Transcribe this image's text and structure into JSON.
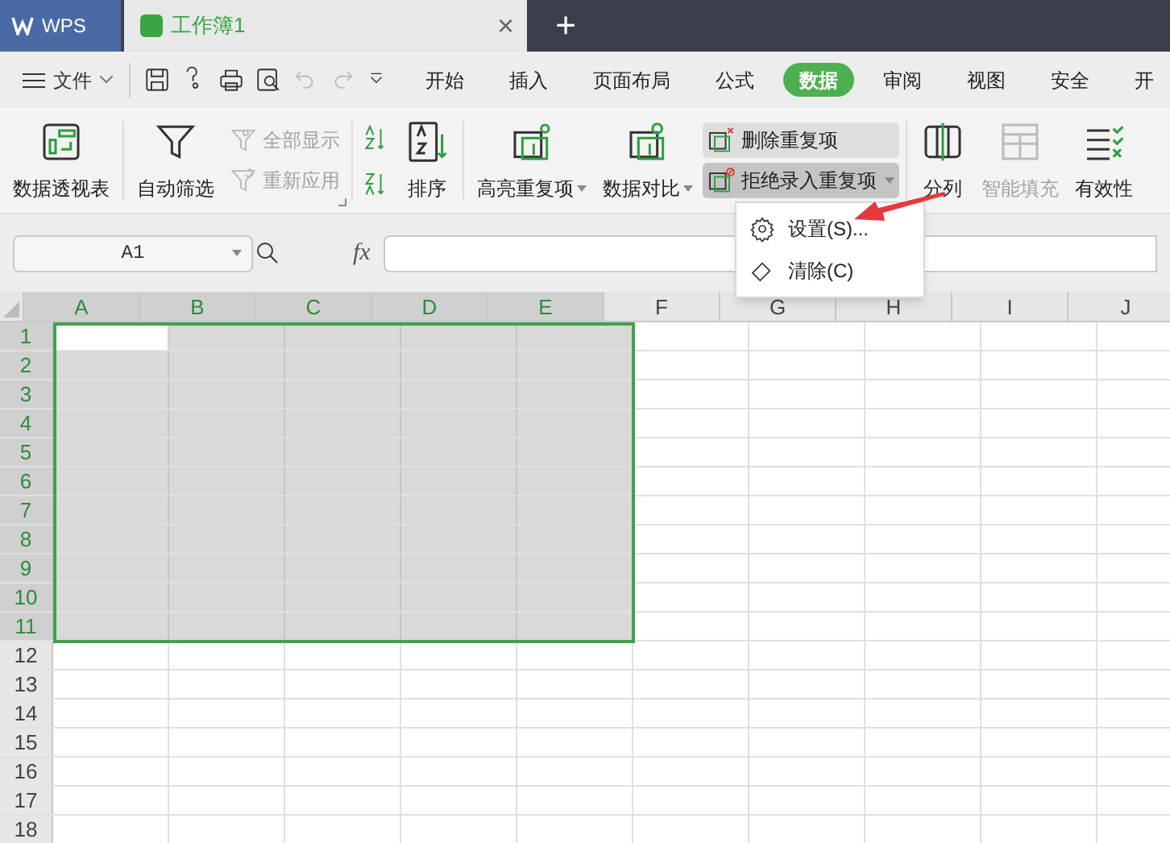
{
  "app_tab": {
    "label": "WPS"
  },
  "doc_tab": {
    "label": "工作簿1",
    "close": "×"
  },
  "new_tab": "+",
  "file_menu": {
    "label": "文件"
  },
  "menu_tabs": [
    {
      "label": "开始",
      "selected": false
    },
    {
      "label": "插入",
      "selected": false
    },
    {
      "label": "页面布局",
      "selected": false
    },
    {
      "label": "公式",
      "selected": false
    },
    {
      "label": "数据",
      "selected": true
    },
    {
      "label": "审阅",
      "selected": false
    },
    {
      "label": "视图",
      "selected": false
    },
    {
      "label": "安全",
      "selected": false
    },
    {
      "label": "开",
      "selected": false
    }
  ],
  "ribbon": [
    {
      "items": [
        {
          "kind": "large",
          "label": "数据透视表",
          "disabled": false,
          "dropdown": false
        }
      ]
    },
    {
      "launcher": true,
      "items": [
        {
          "kind": "large",
          "label": "自动筛选",
          "disabled": false,
          "dropdown": false
        },
        {
          "kind": "stack",
          "items": [
            {
              "label": "全部显示",
              "disabled": true,
              "pressed": false,
              "dropdown": false
            },
            {
              "label": "重新应用",
              "disabled": true,
              "pressed": false,
              "dropdown": false
            }
          ]
        }
      ]
    },
    {
      "items": [
        {
          "kind": "sortpair"
        },
        {
          "kind": "large",
          "label": "排序",
          "disabled": false,
          "dropdown": false
        }
      ]
    },
    {
      "items": [
        {
          "kind": "large",
          "label": "高亮重复项",
          "disabled": false,
          "dropdown": true
        },
        {
          "kind": "large",
          "label": "数据对比",
          "disabled": false,
          "dropdown": true
        },
        {
          "kind": "stack",
          "items": [
            {
              "label": "删除重复项",
              "disabled": false,
              "pressed": false,
              "hover": true,
              "dropdown": false
            },
            {
              "label": "拒绝录入重复项",
              "disabled": false,
              "pressed": true,
              "dropdown": true
            }
          ]
        }
      ]
    },
    {
      "items": [
        {
          "kind": "large",
          "label": "分列",
          "disabled": false,
          "dropdown": false
        },
        {
          "kind": "large",
          "label": "智能填充",
          "disabled": true,
          "dropdown": false
        },
        {
          "kind": "large",
          "label": "有效性",
          "disabled": false,
          "dropdown": false
        }
      ]
    }
  ],
  "dropdown_menu": [
    {
      "label": "设置(S)..."
    },
    {
      "label": "清除(C)"
    }
  ],
  "name_box": {
    "value": "A1"
  },
  "formula_label": "fx",
  "columns": [
    {
      "label": "A",
      "selected": true
    },
    {
      "label": "B",
      "selected": true
    },
    {
      "label": "C",
      "selected": true
    },
    {
      "label": "D",
      "selected": true
    },
    {
      "label": "E",
      "selected": true
    },
    {
      "label": "F",
      "selected": false
    },
    {
      "label": "G",
      "selected": false
    },
    {
      "label": "H",
      "selected": false
    },
    {
      "label": "I",
      "selected": false
    },
    {
      "label": "J",
      "selected": false
    }
  ],
  "rows": [
    {
      "label": "1",
      "selected": true
    },
    {
      "label": "2",
      "selected": true
    },
    {
      "label": "3",
      "selected": true
    },
    {
      "label": "4",
      "selected": true
    },
    {
      "label": "5",
      "selected": true
    },
    {
      "label": "6",
      "selected": true
    },
    {
      "label": "7",
      "selected": true
    },
    {
      "label": "8",
      "selected": true
    },
    {
      "label": "9",
      "selected": true
    },
    {
      "label": "10",
      "selected": true
    },
    {
      "label": "11",
      "selected": true
    },
    {
      "label": "12",
      "selected": false
    },
    {
      "label": "13",
      "selected": false
    },
    {
      "label": "14",
      "selected": false
    },
    {
      "label": "15",
      "selected": false
    },
    {
      "label": "16",
      "selected": false
    },
    {
      "label": "17",
      "selected": false
    },
    {
      "label": "18",
      "selected": false
    }
  ]
}
